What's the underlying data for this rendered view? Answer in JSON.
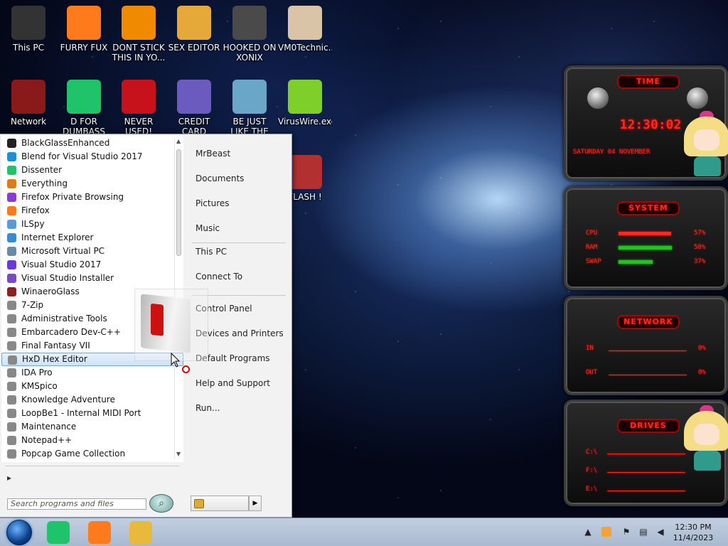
{
  "desktop": {
    "icons": [
      {
        "label": "This PC",
        "icon": "computer-icon",
        "color": "#333333"
      },
      {
        "label": "FURRY FUX",
        "icon": "firefox-icon",
        "color": "#ff7a1a"
      },
      {
        "label": "DONT STICK THIS IN YO...",
        "icon": "vlc-cone-icon",
        "color": "#f08a00"
      },
      {
        "label": "SEX EDITOR",
        "icon": "hxd-icon",
        "color": "#e5a93a"
      },
      {
        "label": "HOOKED ON XONIX",
        "icon": "xonix-icon",
        "color": "#4a4a4a"
      },
      {
        "label": "VM0Technic...",
        "icon": "doctor-avatar-icon",
        "color": "#d9c4a8"
      },
      {
        "label": "Network",
        "icon": "network-icon",
        "color": "#8a1a1a"
      },
      {
        "label": "D FOR DUMBASS",
        "icon": "dissenter-icon",
        "color": "#1fc46a"
      },
      {
        "label": "NEVER USED!",
        "icon": "dev-cpp-icon",
        "color": "#c8121b"
      },
      {
        "label": "CREDIT CARD CHECKER",
        "icon": "credit-card-icon",
        "color": "#6b5bbf"
      },
      {
        "label": "BE JUST LIKE THE DUDE!",
        "icon": "santa-icon",
        "color": "#6aa6c8"
      },
      {
        "label": "VirusWire.exe",
        "icon": "limewire-icon",
        "color": "#7fcf2b"
      },
      {
        "label": "FLASH !",
        "icon": "flash-drive-icon",
        "color": "#b33030"
      }
    ]
  },
  "start_menu": {
    "programs": [
      {
        "label": "BlackGlassEnhanced",
        "color": "#222222"
      },
      {
        "label": "Blend for Visual Studio 2017",
        "color": "#1e8fd6"
      },
      {
        "label": "Dissenter",
        "color": "#1fc46a"
      },
      {
        "label": "Everything",
        "color": "#e07a1a"
      },
      {
        "label": "Firefox Private Browsing",
        "color": "#8a3ad6"
      },
      {
        "label": "Firefox",
        "color": "#ff7a1a"
      },
      {
        "label": "ILSpy",
        "color": "#5a9ad6"
      },
      {
        "label": "Internet Explorer",
        "color": "#3a8ad6"
      },
      {
        "label": "Microsoft Virtual PC",
        "color": "#6a8aa8"
      },
      {
        "label": "Visual Studio 2017",
        "color": "#6a3ad6"
      },
      {
        "label": "Visual Studio Installer",
        "color": "#7a4ac6"
      },
      {
        "label": "WinaeroGlass",
        "color": "#8a2020"
      },
      {
        "label": "7-Zip",
        "color": "#888888"
      },
      {
        "label": "Administrative Tools",
        "color": "#888888"
      },
      {
        "label": "Embarcadero Dev-C++",
        "color": "#888888"
      },
      {
        "label": "Final Fantasy VII",
        "color": "#888888"
      },
      {
        "label": "HxD Hex Editor",
        "color": "#888888",
        "selected": true
      },
      {
        "label": "IDA Pro",
        "color": "#888888"
      },
      {
        "label": "KMSpico",
        "color": "#888888"
      },
      {
        "label": "Knowledge Adventure",
        "color": "#888888"
      },
      {
        "label": "LoopBe1 - Internal MIDI Port",
        "color": "#888888"
      },
      {
        "label": "Maintenance",
        "color": "#888888"
      },
      {
        "label": "Notepad++",
        "color": "#888888"
      },
      {
        "label": "Popcap Game Collection",
        "color": "#888888"
      }
    ],
    "all_programs_arrow": "▸",
    "search_placeholder": "Search programs and files",
    "right_links": [
      {
        "label": "MrBeast"
      },
      {
        "label": "Documents"
      },
      {
        "label": "Pictures"
      },
      {
        "label": "Music"
      },
      {
        "label": "This PC"
      },
      {
        "label": "Connect To"
      },
      {
        "label": "Control Panel"
      },
      {
        "label": "Devices and Printers"
      },
      {
        "label": "Default Programs"
      },
      {
        "label": "Help and Support"
      },
      {
        "label": "Run..."
      }
    ]
  },
  "gadgets": {
    "time": {
      "header": "TIME",
      "clock": "12:30:02",
      "date": "SATURDAY 04 NOVEMBER"
    },
    "system": {
      "header": "SYSTEM",
      "rows": [
        {
          "label": "CPU",
          "value": "57%",
          "level": 0.57
        },
        {
          "label": "RAM",
          "value": "58%",
          "level": 0.58
        },
        {
          "label": "SWAP",
          "value": "37%",
          "level": 0.37
        }
      ]
    },
    "network": {
      "header": "NETWORK",
      "rows": [
        {
          "label": "IN",
          "value": "0%"
        },
        {
          "label": "OUT",
          "value": "0%"
        }
      ]
    },
    "drives": {
      "header": "DRIVES",
      "rows": [
        {
          "label": "C:\\"
        },
        {
          "label": "F:\\"
        },
        {
          "label": "E:\\"
        }
      ]
    }
  },
  "taskbar": {
    "pinned": [
      {
        "icon": "dissenter-icon",
        "color": "#1fc46a"
      },
      {
        "icon": "firefox-icon",
        "color": "#ff7a1a"
      },
      {
        "icon": "file-explorer-icon",
        "color": "#e8b93a"
      }
    ],
    "clock": {
      "time": "12:30 PM",
      "date": "11/4/2023"
    }
  }
}
